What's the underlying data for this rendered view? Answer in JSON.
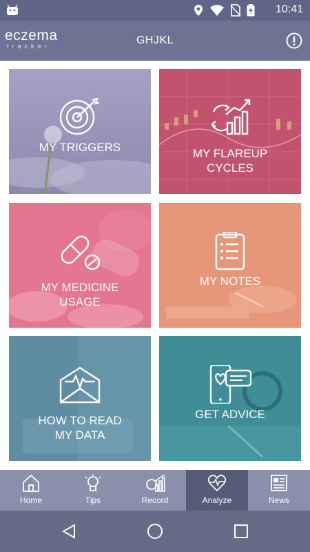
{
  "status_bar": {
    "time": "10:41"
  },
  "app_bar": {
    "logo_word": "eczema",
    "logo_sub": "tracker",
    "title": "GHJKL"
  },
  "tiles": [
    {
      "line1": "MY TRIGGERS",
      "line2": "",
      "icon": "target-icon"
    },
    {
      "line1": "MY FLAREUP",
      "line2": "CYCLES",
      "icon": "cycle-chart-icon"
    },
    {
      "line1": "MY MEDICINE",
      "line2": "USAGE",
      "icon": "pill-icon"
    },
    {
      "line1": "MY NOTES",
      "line2": "",
      "icon": "clipboard-icon"
    },
    {
      "line1": "HOW TO READ",
      "line2": "MY DATA",
      "icon": "heartbeat-envelope-icon"
    },
    {
      "line1": "GET ADVICE",
      "line2": "",
      "icon": "phone-chat-icon"
    }
  ],
  "bottom_nav": {
    "active": "Analyze",
    "items": [
      {
        "label": "Home",
        "icon": "home-icon"
      },
      {
        "label": "Tips",
        "icon": "lightbulb-icon"
      },
      {
        "label": "Record",
        "icon": "record-chart-icon"
      },
      {
        "label": "Analyze",
        "icon": "heart-pulse-icon"
      },
      {
        "label": "News",
        "icon": "newspaper-icon"
      }
    ]
  },
  "colors": {
    "status_bar": "#5e6587",
    "app_bar": "#6c7393",
    "tile_triggers": "#9c93bd",
    "tile_flareup": "#c2536f",
    "tile_medicine": "#e5768f",
    "tile_notes": "#e69779",
    "tile_howto": "#5e8ca2",
    "tile_advice": "#3f8e97",
    "bottom_nav": "#8a90ab",
    "bottom_nav_active": "#565c78",
    "system_nav": "#666c88"
  }
}
